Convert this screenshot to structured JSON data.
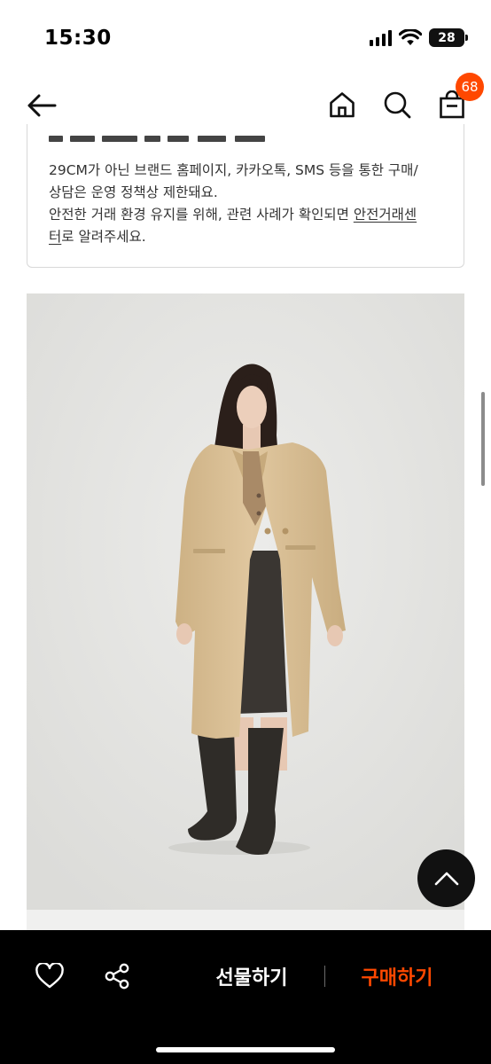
{
  "status_bar": {
    "time": "15:30",
    "battery": "28"
  },
  "nav": {
    "cart_count": "68"
  },
  "notice": {
    "line1": "29CM가 아닌 브랜드 홈페이지, 카카오톡, SMS 등을 통한 구매/",
    "line2": "상담은 운영 정책상 제한돼요.",
    "line3_prefix": "안전한 거래 환경 유지를 위해, 관련 사례가 확인되면 ",
    "line3_link": "안전거래센",
    "line4_link": "터",
    "line4_suffix": "로 알려주세요."
  },
  "product": {
    "image_icon": "model-wearing-beige-wool-coat"
  },
  "bottom_bar": {
    "gift_label": "선물하기",
    "buy_label": "구매하기"
  },
  "colors": {
    "accent": "#ff4800",
    "bottom_bar_bg": "#000000",
    "coat": "#dcc298"
  },
  "icons": [
    "back-arrow-icon",
    "home-icon",
    "search-icon",
    "shopping-bag-icon",
    "heart-icon",
    "share-icon",
    "chevron-up-icon"
  ]
}
